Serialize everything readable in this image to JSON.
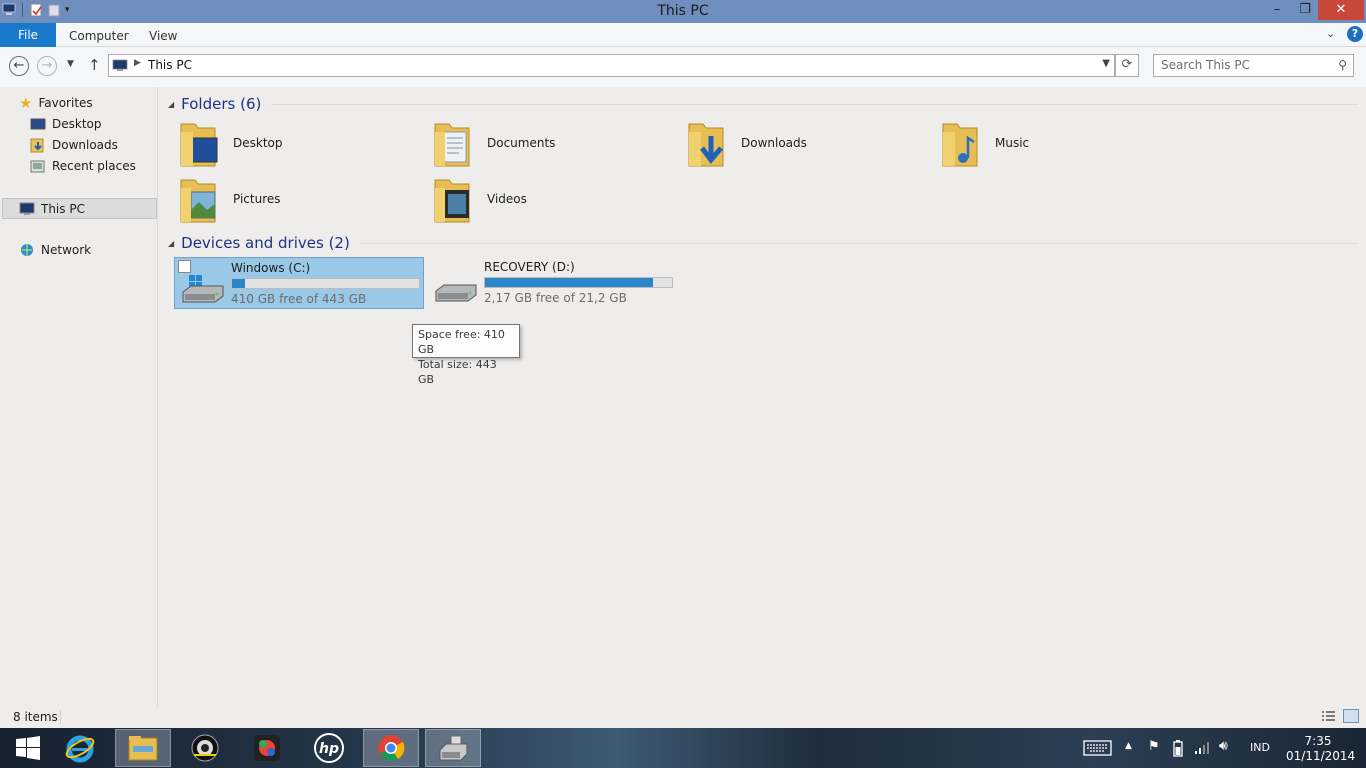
{
  "window": {
    "title": "This PC"
  },
  "ribbon": {
    "file_label": "File",
    "tabs": [
      "Computer",
      "View"
    ]
  },
  "address": {
    "crumb": "This PC"
  },
  "search": {
    "placeholder": "Search This PC"
  },
  "navpane": {
    "favorites": "Favorites",
    "items": [
      "Desktop",
      "Downloads",
      "Recent places"
    ],
    "this_pc": "This PC",
    "network": "Network"
  },
  "groups": {
    "folders_title": "Folders (6)",
    "folders": [
      "Desktop",
      "Documents",
      "Downloads",
      "Music",
      "Pictures",
      "Videos"
    ],
    "devices_title": "Devices and drives (2)"
  },
  "drives": [
    {
      "name": "Windows (C:)",
      "free": "410 GB free of 443 GB",
      "used_fraction": 0.07
    },
    {
      "name": "RECOVERY (D:)",
      "free": "2,17 GB free of 21,2 GB",
      "used_fraction": 0.9
    }
  ],
  "tooltip": {
    "line1": "Space free: 410 GB",
    "line2": "Total size: 443 GB"
  },
  "status": {
    "count": "8 items"
  },
  "tray": {
    "language": "IND",
    "time": "7:35",
    "date": "01/11/2014"
  },
  "colors": {
    "title_bar": "#6e8fbe",
    "file_tab": "#1979ca",
    "close": "#c7483b",
    "group_title": "#1e3287",
    "selection": "#99c9e6",
    "drive_bar": "#2b86c9"
  }
}
